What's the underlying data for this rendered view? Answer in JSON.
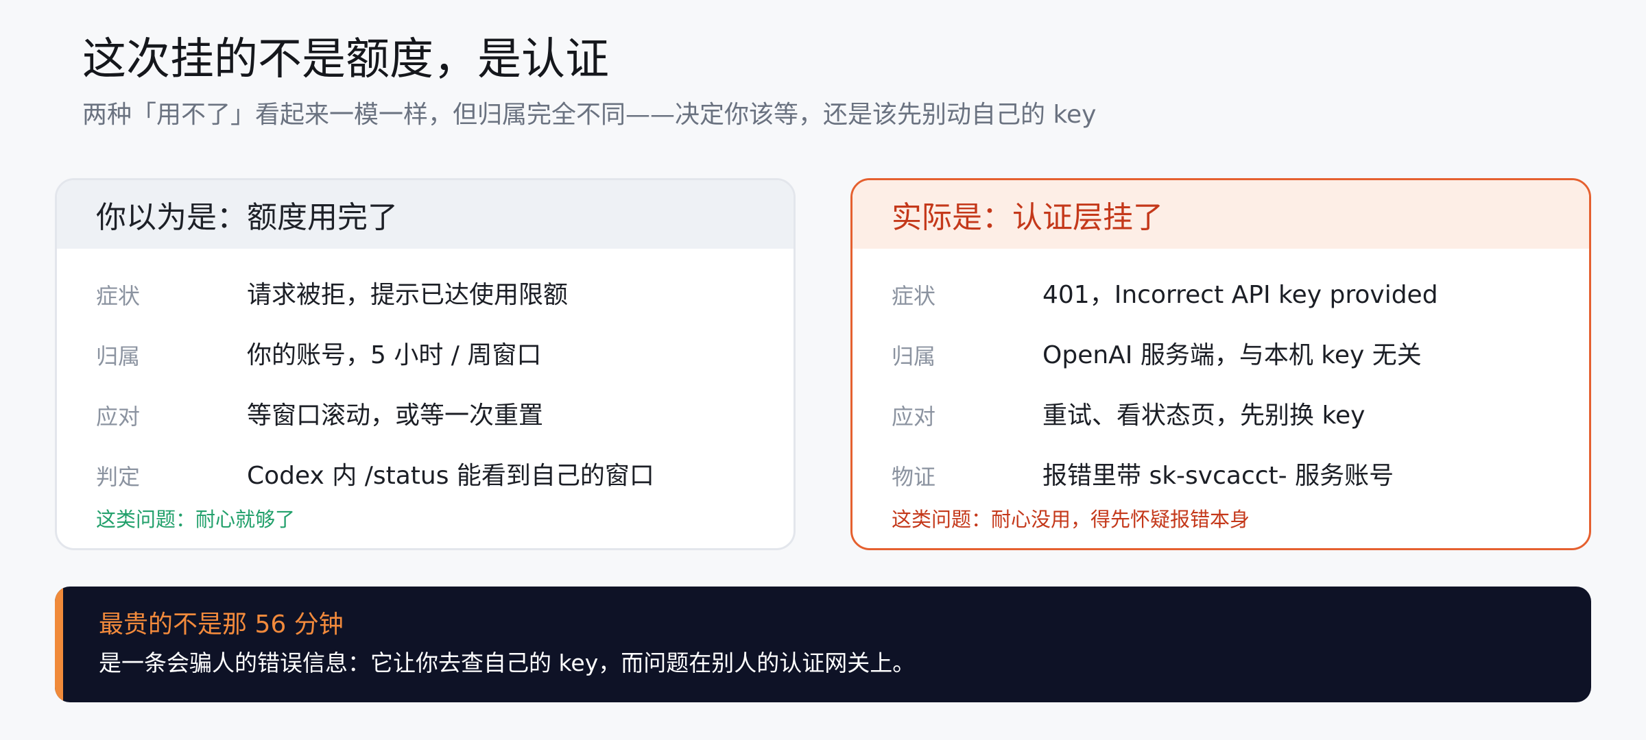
{
  "header": {
    "title": "这次挂的不是额度，是认证",
    "subtitle": "两种「用不了」看起来一模一样，但归属完全不同——决定你该等，还是该先别动自己的 key"
  },
  "left_card": {
    "title": "你以为是：额度用完了",
    "rows": [
      {
        "label": "症状",
        "value": "请求被拒，提示已达使用限额"
      },
      {
        "label": "归属",
        "value": "你的账号，5 小时 / 周窗口"
      },
      {
        "label": "应对",
        "value": "等窗口滚动，或等一次重置"
      },
      {
        "label": "判定",
        "value": "Codex 内 /status 能看到自己的窗口"
      }
    ],
    "footer": "这类问题：耐心就够了"
  },
  "right_card": {
    "title": "实际是：认证层挂了",
    "rows": [
      {
        "label": "症状",
        "value": "401，Incorrect API key provided"
      },
      {
        "label": "归属",
        "value": "OpenAI 服务端，与本机 key 无关"
      },
      {
        "label": "应对",
        "value": "重试、看状态页，先别换 key"
      },
      {
        "label": "物证",
        "value": "报错里带 sk-svcacct- 服务账号"
      }
    ],
    "footer": "这类问题：耐心没用，得先怀疑报错本身"
  },
  "callout": {
    "title": "最贵的不是那 56 分钟",
    "body": "是一条会骗人的错误信息：它让你去查自己的 key，而问题在别人的认证网关上。"
  },
  "colors": {
    "page_background": "#f7f8fa",
    "accent_orange": "#e5602f",
    "alert_red": "#c4381a",
    "ok_green": "#22a06b",
    "callout_background": "#0e1226",
    "callout_accent": "#f08a3a"
  }
}
